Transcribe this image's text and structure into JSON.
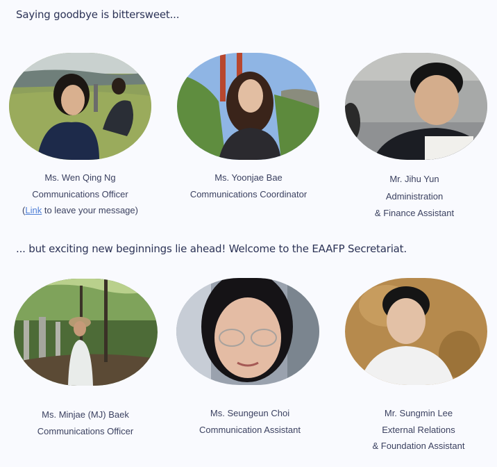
{
  "farewell": {
    "heading": "Saying goodbye is bittersweet...",
    "people": [
      {
        "name": "Ms. Wen Qing Ng",
        "role_lines": [
          "Communications Officer"
        ],
        "note_open": "(",
        "link": "Link",
        "note_rest": " to leave your message)"
      },
      {
        "name": "Ms. Yoonjae Bae",
        "role_lines": [
          "Communications Coordinator"
        ]
      },
      {
        "name": "Mr. Jihu Yun",
        "role_lines": [
          "Administration",
          "& Finance Assistant"
        ]
      }
    ]
  },
  "welcome": {
    "heading": "... but exciting new beginnings lie ahead! Welcome to the EAAFP Secretariat.",
    "people": [
      {
        "name": "Ms. Minjae (MJ) Baek",
        "role_lines": [
          "Communications Officer"
        ]
      },
      {
        "name": "Ms. Seungeun Choi",
        "role_lines": [
          "Communication Assistant"
        ]
      },
      {
        "name": "Mr. Sungmin Lee",
        "role_lines": [
          "External Relations",
          "& Foundation Assistant"
        ]
      }
    ]
  }
}
